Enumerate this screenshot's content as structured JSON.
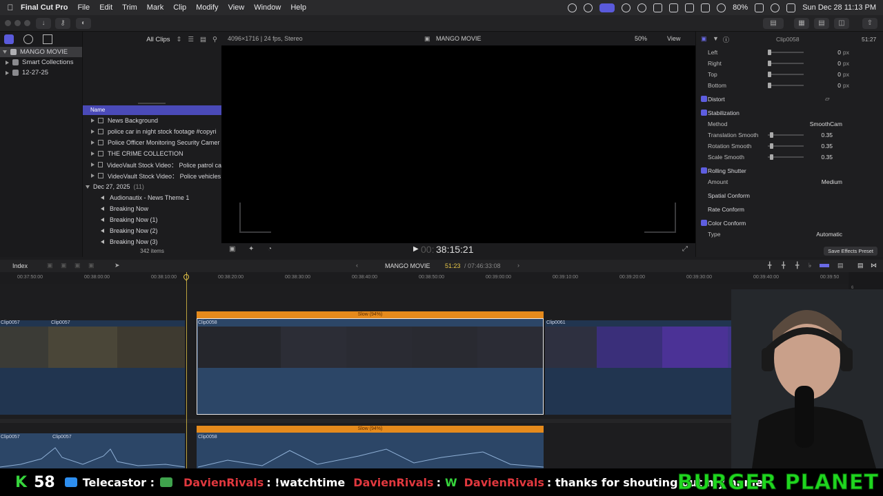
{
  "menubar": {
    "app_name": "Final Cut Pro",
    "items": [
      "File",
      "Edit",
      "Trim",
      "Mark",
      "Clip",
      "Modify",
      "View",
      "Window",
      "Help"
    ],
    "battery": "80%",
    "datetime": "Sun Dec 28  11:13 PM"
  },
  "library": {
    "name": "MANGO MOVIE",
    "items": [
      "Smart Collections",
      "12-27-25"
    ]
  },
  "browser": {
    "filter": "All Clips",
    "column_name": "Name",
    "rows": [
      "News Background",
      "police  car in night stock footage #copyri",
      "Police Officer Monitoring Security Camer",
      "THE CRIME COLLECTION",
      "VideoVault Stock Video：  Police patrol ca",
      "VideoVault Stock Video：  Police vehicles"
    ],
    "date_group": "Dec 27, 2025",
    "date_group_count": "(11)",
    "audio_rows": [
      "Audionautix - News Theme 1",
      "Breaking Now",
      "Breaking Now (1)",
      "Breaking Now (2)",
      "Breaking Now (3)"
    ],
    "item_count": "342 items"
  },
  "viewer": {
    "format": "4096×1716 | 24 fps, Stereo",
    "project": "MANGO MOVIE",
    "zoom": "50%",
    "view": "View",
    "timecode_dim": "00:",
    "timecode": "38:15:21"
  },
  "inspector": {
    "clip_name": "Clip0058",
    "duration": "51:27",
    "rows": {
      "left": {
        "label": "Left",
        "value": "0",
        "unit": "px"
      },
      "right": {
        "label": "Right",
        "value": "0",
        "unit": "px"
      },
      "top": {
        "label": "Top",
        "value": "0",
        "unit": "px"
      },
      "bottom": {
        "label": "Bottom",
        "value": "0",
        "unit": "px"
      }
    },
    "distort": "Distort",
    "stabilization": "Stabilization",
    "method_label": "Method",
    "method_value": "SmoothCam",
    "translation_label": "Translation Smooth",
    "translation_value": "0.35",
    "rotation_label": "Rotation Smooth",
    "rotation_value": "0.35",
    "scale_label": "Scale Smooth",
    "scale_value": "0.35",
    "rolling_shutter": "Rolling Shutter",
    "amount_label": "Amount",
    "amount_value": "Medium",
    "spatial_conform": "Spatial Conform",
    "rate_conform": "Rate Conform",
    "color_conform": "Color Conform",
    "type_label": "Type",
    "type_value": "Automatic",
    "save_preset": "Save Effects Preset"
  },
  "timeline": {
    "index": "Index",
    "project": "MANGO MOVIE",
    "position": "51:23",
    "total": "/ 07:46:33:08",
    "ruler": [
      "00:37:50:00",
      "00:38:00:00",
      "00:38:10:00",
      "00:38:20:00",
      "00:38:30:00",
      "00:38:40:00",
      "00:38:50:00",
      "00:39:00:00",
      "00:39:10:00",
      "00:39:20:00",
      "00:39:30:00",
      "00:39:40:00",
      "00:39:50"
    ],
    "clips": {
      "a": "Clip0057",
      "b": "Clip0057",
      "c": "Clip0058",
      "d": "Clip0061",
      "audio_a": "Clip0057",
      "audio_b": "Clip0057",
      "audio_c": "Clip0058"
    },
    "retime_label": "Slow (94%)"
  },
  "stream": {
    "k_label": "K",
    "count": "58",
    "user1": "Telecastor :",
    "user2": "DavienRivals",
    "msg2": ": !watchtime",
    "user3": "DavienRivals",
    "msg3": ":",
    "w": "W",
    "user4": "DavienRivals",
    "msg4": ": thanks for shouting out my name",
    "sponsor": "BURGER PLANET"
  }
}
